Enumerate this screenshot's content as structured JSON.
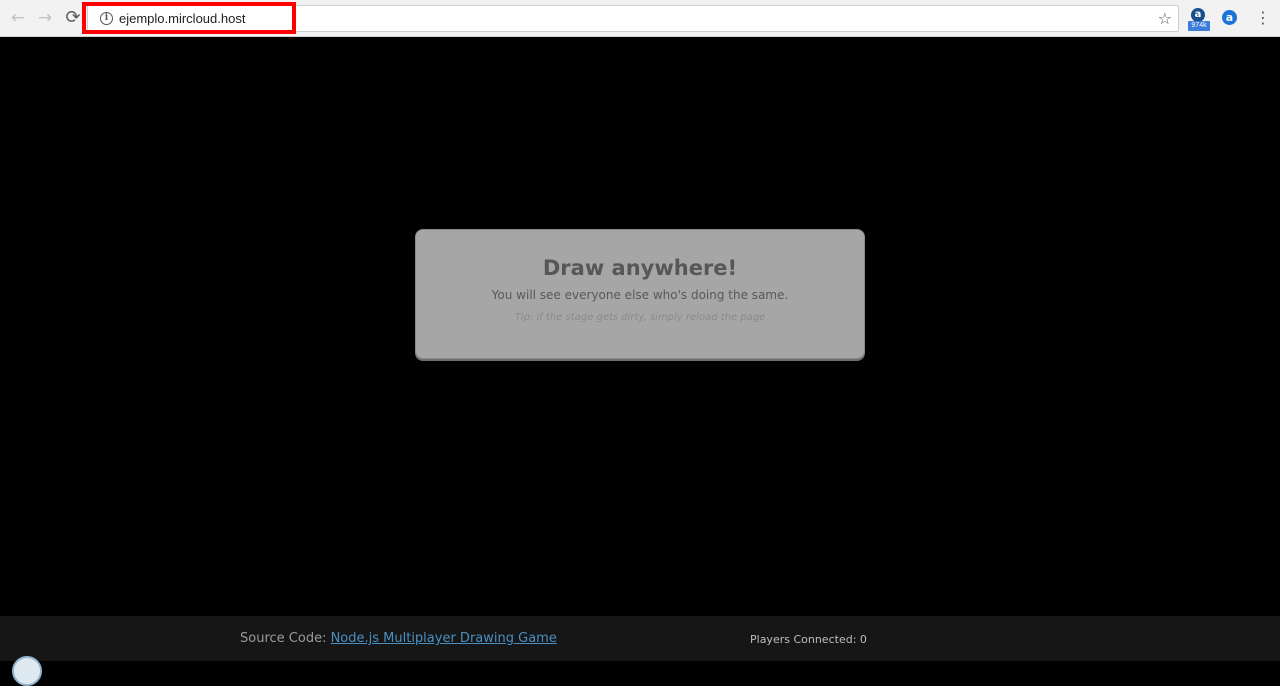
{
  "browser": {
    "back_glyph": "←",
    "forward_glyph": "→",
    "reload_glyph": "⟳",
    "url": "ejemplo.mircloud.host",
    "info_glyph": "i",
    "star_glyph": "☆",
    "menu_glyph": "⋮",
    "extension_1": {
      "glyph": "a",
      "badge": "974k"
    },
    "extension_2": {
      "glyph": "a"
    },
    "highlight_color": "#ff0000"
  },
  "panel": {
    "title": "Draw anywhere!",
    "subtitle": "You will see everyone else who's doing the same.",
    "tip": "Tip: if the stage gets dirty, simply reload the page"
  },
  "footer": {
    "source_prefix": "Source Code: ",
    "source_link": "Node.js Multiplayer Drawing Game",
    "players_connected": "Players Connected: 0",
    "link_color": "#4a8fc2"
  },
  "icons": [
    "back-arrow-icon",
    "forward-arrow-icon",
    "reload-icon",
    "info-icon",
    "star-icon",
    "extension-icon",
    "menu-icon"
  ]
}
